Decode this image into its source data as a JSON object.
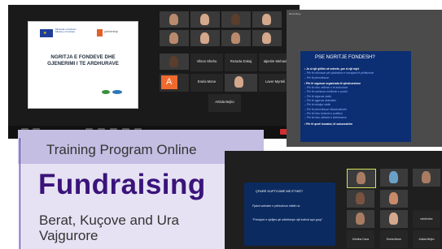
{
  "zoom_window_1": {
    "slide": {
      "org1_lines": [
        "Ministria e Kulturës",
        "Ministry of Culture"
      ],
      "org2": "partnership",
      "title_line1": "NGRITJA E FONDEVE DHE",
      "title_line2": "GJENERIMI I TE ARDHURAVE"
    },
    "participants": [
      {
        "name": "Vilson Shehu"
      },
      {
        "name": "Rezarta Dokaj"
      },
      {
        "name": "alpetim Mehani"
      },
      {
        "name": "Enela Mone"
      },
      {
        "name": "Laver Myrteli"
      },
      {
        "name": "Artiola Bejko"
      }
    ],
    "avatar_letter": "A",
    "end_label": "End"
  },
  "zoom_window_2": {
    "top_label": "Recording...",
    "slide": {
      "title": "PSE NGRITJE FONDESH?",
      "items": [
        {
          "main": "Jo si një qëllim në vetvete, por si një mjet",
          "subs": [
            "Për të ndihmuar për plotësimin e nevojave të përfituesve",
            "Për të përmirësuar"
          ]
        },
        {
          "main": "Për të siguruar organizata të qëndrueshme",
          "subs": [
            "Për të rritur vëllimin e të ardhurave",
            "Për të vazhduar zhvillimin e punës",
            "Për të siguruar stafin",
            "Për të zgjeruar aktivitetin",
            "Për të mbajtur stafin",
            "Për të përmirësuar infrastrukturën",
            "Për të rritur besimin e publikut",
            "Për të rritur cilësinë e shërbimeve"
          ]
        },
        {
          "main": "Për të qenë inovator, të suksesshëm",
          "subs": []
        }
      ]
    }
  },
  "banner": {
    "subtitle": "Training Program Online",
    "title": "Fundraising",
    "location_line1": "Berat, Kuçove and Ura",
    "location_line2": "Vajgurore"
  },
  "zoom_window_3": {
    "slide": {
      "title": "ÇFARË KUPTOJMË ME ETIKË?",
      "line1": "Fjalori webster e përkufizon etikën si:",
      "line2": "\"Principet e sjelljes që udhëheqin një individ apo grup\""
    },
    "participants": [
      {
        "name": ""
      },
      {
        "name": ""
      },
      {
        "name": ""
      },
      {
        "name": ""
      },
      {
        "name": ""
      },
      {
        "name": "rshidi elez"
      },
      {
        "name": ""
      },
      {
        "name": ""
      },
      {
        "name": ""
      },
      {
        "name": "Kristina Ceca"
      },
      {
        "name": "Enela Mone"
      },
      {
        "name": "Artiola Bejko"
      }
    ]
  }
}
